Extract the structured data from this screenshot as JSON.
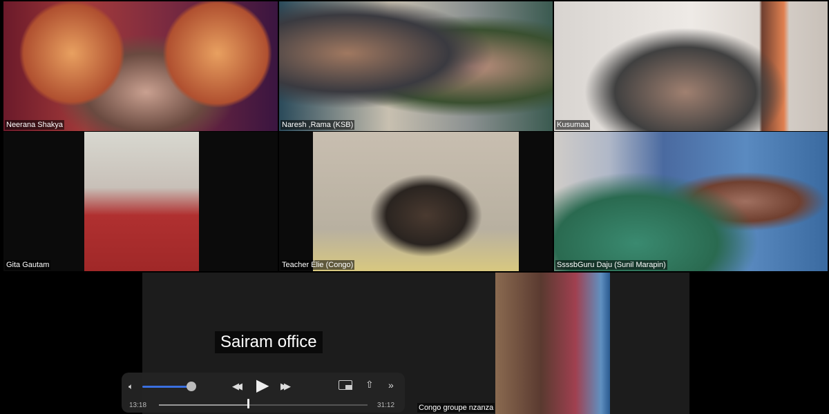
{
  "participants": [
    {
      "name": "Neerana Shakya"
    },
    {
      "name": "Naresh ,Rama (KSB)"
    },
    {
      "name": "Kusumaa"
    },
    {
      "name": "Gita Gautam"
    },
    {
      "name": "Teacher Élie (Congo)"
    },
    {
      "name": "SsssbGuru Daju (Sunil Marapin)"
    },
    {
      "name": "Sairam office",
      "caption": "Sairam office"
    },
    {
      "name": "Congo groupe nzanza"
    }
  ],
  "player": {
    "current_time": "13:18",
    "duration": "31:12",
    "progress": 0.426,
    "volume": 0.9,
    "icons": [
      "speaker-icon",
      "rewind-icon",
      "play-icon",
      "fast-forward-icon",
      "picture-in-picture-icon",
      "share-icon",
      "more-chevron-icon"
    ]
  }
}
